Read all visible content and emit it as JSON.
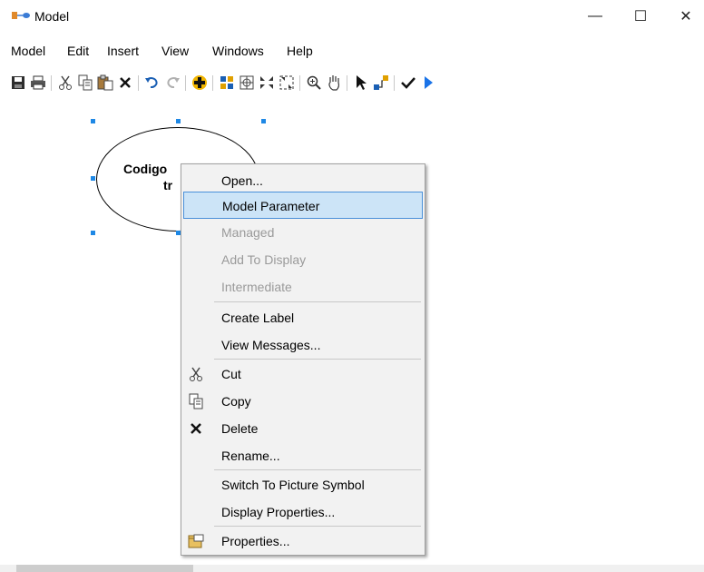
{
  "window": {
    "title": "Model",
    "minimize_glyph": "—",
    "maximize_glyph": "☐",
    "close_glyph": "✕"
  },
  "menubar": {
    "items": [
      "Model",
      "Edit",
      "Insert",
      "View",
      "Windows",
      "Help"
    ]
  },
  "toolbar": {
    "icons": [
      "save-icon",
      "print-icon",
      "cut-icon",
      "copy-icon",
      "paste-icon",
      "delete-icon",
      "undo-icon",
      "redo-icon",
      "add-data-icon",
      "auto-layout-icon",
      "full-extent-icon",
      "fixed-zoom-in-icon",
      "fixed-zoom-out-icon",
      "zoom-in-icon",
      "pan-icon",
      "select-icon",
      "connect-icon",
      "validate-icon",
      "run-icon"
    ]
  },
  "canvas": {
    "node_label_line1": "Codigo",
    "node_label_line2": "tr"
  },
  "context_menu": {
    "items": [
      {
        "label": "Open...",
        "state": "normal"
      },
      {
        "label": "Model Parameter",
        "state": "selected"
      },
      {
        "label": "Managed",
        "state": "disabled"
      },
      {
        "label": "Add To Display",
        "state": "disabled"
      },
      {
        "label": "Intermediate",
        "state": "disabled"
      },
      {
        "label": "Create Label",
        "state": "normal"
      },
      {
        "label": "View Messages...",
        "state": "normal"
      },
      {
        "label": "Cut",
        "state": "normal",
        "icon": "cut-icon"
      },
      {
        "label": "Copy",
        "state": "normal",
        "icon": "copy-icon"
      },
      {
        "label": "Delete",
        "state": "normal",
        "icon": "delete-icon"
      },
      {
        "label": "Rename...",
        "state": "normal"
      },
      {
        "label": "Switch To Picture Symbol",
        "state": "normal"
      },
      {
        "label": "Display Properties...",
        "state": "normal"
      },
      {
        "label": "Properties...",
        "state": "normal",
        "icon": "properties-icon"
      }
    ]
  },
  "colors": {
    "selection_handle": "#1e88e5",
    "menu_highlight": "#cce4f7",
    "menu_highlight_border": "#4a90d9",
    "disabled_text": "#9a9a9a"
  }
}
